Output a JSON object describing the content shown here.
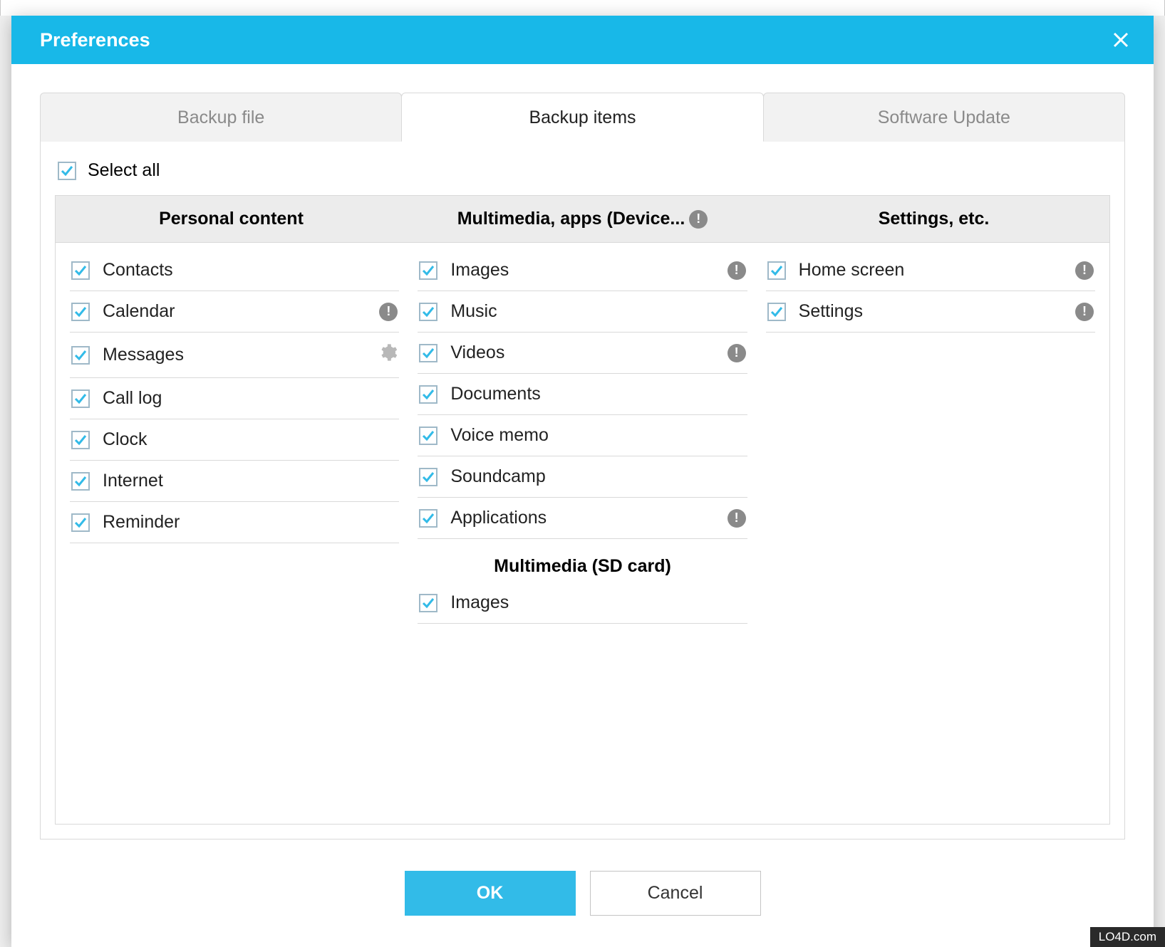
{
  "window": {
    "title": "Preferences"
  },
  "tabs": {
    "items": [
      {
        "label": "Backup file",
        "active": false
      },
      {
        "label": "Backup items",
        "active": true
      },
      {
        "label": "Software Update",
        "active": false
      }
    ]
  },
  "select_all": {
    "label": "Select all",
    "checked": true
  },
  "columns": {
    "personal": {
      "header": "Personal content"
    },
    "multimedia": {
      "header": "Multimedia, apps (Device...",
      "has_info": true
    },
    "settings": {
      "header": "Settings, etc."
    }
  },
  "items": {
    "personal": [
      {
        "label": "Contacts",
        "checked": true
      },
      {
        "label": "Calendar",
        "checked": true,
        "info": true
      },
      {
        "label": "Messages",
        "checked": true,
        "gear": true
      },
      {
        "label": "Call log",
        "checked": true
      },
      {
        "label": "Clock",
        "checked": true
      },
      {
        "label": "Internet",
        "checked": true
      },
      {
        "label": "Reminder",
        "checked": true
      }
    ],
    "multimedia": [
      {
        "label": "Images",
        "checked": true,
        "info": true
      },
      {
        "label": "Music",
        "checked": true
      },
      {
        "label": "Videos",
        "checked": true,
        "info": true
      },
      {
        "label": "Documents",
        "checked": true
      },
      {
        "label": "Voice memo",
        "checked": true
      },
      {
        "label": "Soundcamp",
        "checked": true
      },
      {
        "label": "Applications",
        "checked": true,
        "info": true
      }
    ],
    "multimedia_sd_header": "Multimedia (SD card)",
    "multimedia_sd": [
      {
        "label": "Images",
        "checked": true
      }
    ],
    "settings": [
      {
        "label": "Home screen",
        "checked": true,
        "info": true
      },
      {
        "label": "Settings",
        "checked": true,
        "info": true
      }
    ]
  },
  "buttons": {
    "ok": "OK",
    "cancel": "Cancel"
  },
  "watermark": "LO4D.com"
}
